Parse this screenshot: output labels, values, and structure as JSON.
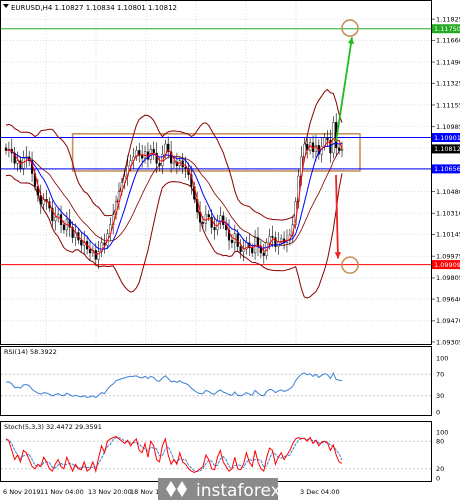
{
  "chart_data": {
    "type": "candlestick",
    "title": "EURUSD,H4  1.10827 1.10834 1.10801 1.10812",
    "ylim": [
      1.09305,
      1.11865
    ],
    "price_axis_ticks": [
      "1.11825",
      "1.11660",
      "1.11490",
      "1.11325",
      "1.11155",
      "1.10985",
      "1.10820",
      "1.10650",
      "1.10480",
      "1.10310",
      "1.10145",
      "1.09975",
      "1.09805",
      "1.09640",
      "1.09470",
      "1.09305"
    ],
    "price_tags": [
      {
        "label": "1.11750",
        "value": 1.1175,
        "color": "#22aa22"
      },
      {
        "label": "1.10901",
        "value": 1.10901,
        "color": "#0000ff"
      },
      {
        "label": "1.10812",
        "value": 1.10812,
        "color": "#000000"
      },
      {
        "label": "1.10656",
        "value": 1.10656,
        "color": "#0000ff"
      },
      {
        "label": "1.09909",
        "value": 1.09909,
        "color": "#ff0000"
      }
    ],
    "time_labels": [
      "6 Nov 2019",
      "11 Nov 04:00",
      "13 Nov 20:00",
      "18 Nov 12:00",
      "3 Dec 04:00"
    ],
    "close_series": [
      1.108,
      1.1081,
      1.1078,
      1.107,
      1.1072,
      1.1066,
      1.1074,
      1.1075,
      1.1072,
      1.1062,
      1.1052,
      1.1045,
      1.1038,
      1.1042,
      1.104,
      1.1035,
      1.1025,
      1.1028,
      1.103,
      1.1022,
      1.1018,
      1.1026,
      1.102,
      1.1012,
      1.1016,
      1.101,
      1.1006,
      1.1009,
      1.1003,
      1.1,
      1.1002,
      1.0995,
      1.1001,
      1.1008,
      1.1006,
      1.1015,
      1.1022,
      1.103,
      1.104,
      1.1048,
      1.1055,
      1.106,
      1.1068,
      1.1072,
      1.1075,
      1.108,
      1.1076,
      1.1074,
      1.1079,
      1.1073,
      1.1081,
      1.1078,
      1.107,
      1.1068,
      1.1077,
      1.1085,
      1.1079,
      1.107,
      1.1071,
      1.1068,
      1.1072,
      1.1067,
      1.1066,
      1.1061,
      1.1052,
      1.1042,
      1.1032,
      1.1024,
      1.1023,
      1.103,
      1.1028,
      1.102,
      1.1018,
      1.1025,
      1.1029,
      1.1022,
      1.1018,
      1.101,
      1.1008,
      1.1015,
      1.1005,
      1.1001,
      1.1003,
      1.1008,
      1.1004,
      1.1,
      1.1012,
      1.1005,
      1.1,
      1.0998,
      1.1008,
      1.1013,
      1.1012,
      1.1005,
      1.1009,
      1.1011,
      1.1008,
      1.101,
      1.1014,
      1.1022,
      1.104,
      1.106,
      1.1075,
      1.1085,
      1.108,
      1.1086,
      1.1079,
      1.1084,
      1.1077,
      1.1083,
      1.109,
      1.1088,
      1.1078,
      1.1102,
      1.1082,
      1.108,
      1.1081
    ],
    "levels": [
      {
        "value": 1.1175,
        "color": "#22aa22"
      },
      {
        "value": 1.10901,
        "color": "#0000ff"
      },
      {
        "value": 1.10656,
        "color": "#0000ff"
      },
      {
        "value": 1.09909,
        "color": "#ff0000"
      }
    ],
    "range_box": {
      "value_top": 1.1093,
      "value_bottom": 1.1064,
      "color": "#c8905a"
    },
    "arrows": [
      {
        "direction": "up",
        "color": "#22bb22",
        "target_value": 1.1173
      },
      {
        "direction": "down",
        "color": "#ee2222",
        "target_value": 1.0991
      }
    ],
    "target_circles": [
      {
        "value": 1.11755,
        "color": "#c8905a"
      },
      {
        "value": 1.09905,
        "color": "#c8905a"
      }
    ],
    "colors": {
      "candle": "#000000",
      "ma_fast": "#ff0000",
      "ma_mid": "#0000ff",
      "bands": "#8b0000",
      "bands_mid": "#800000",
      "rsi": "#3d7fd6",
      "stoch_main": "#ff0000",
      "stoch_signal": "#3d7fd6"
    },
    "rsi": {
      "title": "RSI(14) 58.3922",
      "ticks": [
        "100",
        "70",
        "30",
        "0"
      ],
      "levels": [
        70,
        30
      ],
      "values": [
        55,
        56,
        52,
        45,
        46,
        44,
        50,
        51,
        49,
        42,
        38,
        35,
        33,
        36,
        35,
        33,
        30,
        32,
        34,
        31,
        30,
        35,
        32,
        29,
        31,
        29,
        28,
        30,
        27,
        28,
        30,
        27,
        31,
        36,
        34,
        42,
        48,
        52,
        58,
        60,
        62,
        63,
        65,
        66,
        66,
        67,
        64,
        63,
        66,
        62,
        66,
        64,
        58,
        57,
        63,
        67,
        62,
        56,
        57,
        55,
        58,
        54,
        53,
        50,
        44,
        40,
        36,
        34,
        34,
        40,
        38,
        34,
        33,
        38,
        41,
        37,
        35,
        32,
        31,
        37,
        31,
        30,
        32,
        36,
        33,
        31,
        40,
        35,
        31,
        30,
        38,
        42,
        41,
        36,
        39,
        41,
        38,
        40,
        43,
        48,
        58,
        65,
        70,
        72,
        69,
        71,
        66,
        70,
        64,
        68,
        71,
        69,
        62,
        72,
        60,
        59,
        58
      ]
    },
    "stoch": {
      "title": "Stoch(5,3,3) 32.4472 29.3591",
      "ticks": [
        "100",
        "80",
        "20",
        "0"
      ],
      "levels": [
        80,
        20
      ],
      "main": [
        85,
        80,
        60,
        40,
        50,
        35,
        60,
        55,
        40,
        25,
        20,
        30,
        25,
        45,
        35,
        20,
        15,
        30,
        40,
        25,
        20,
        45,
        30,
        15,
        30,
        20,
        18,
        35,
        15,
        20,
        35,
        15,
        45,
        70,
        55,
        80,
        85,
        88,
        90,
        85,
        80,
        75,
        82,
        70,
        78,
        85,
        60,
        55,
        75,
        45,
        80,
        70,
        40,
        35,
        70,
        85,
        50,
        30,
        40,
        30,
        55,
        35,
        30,
        20,
        15,
        12,
        15,
        20,
        25,
        50,
        40,
        20,
        18,
        45,
        60,
        35,
        25,
        15,
        20,
        45,
        20,
        18,
        30,
        55,
        35,
        25,
        60,
        35,
        20,
        15,
        45,
        65,
        60,
        30,
        45,
        55,
        40,
        50,
        60,
        75,
        85,
        88,
        85,
        86,
        80,
        88,
        75,
        82,
        70,
        78,
        80,
        76,
        60,
        72,
        50,
        35,
        32
      ]
    },
    "watermark": "instaforex"
  }
}
